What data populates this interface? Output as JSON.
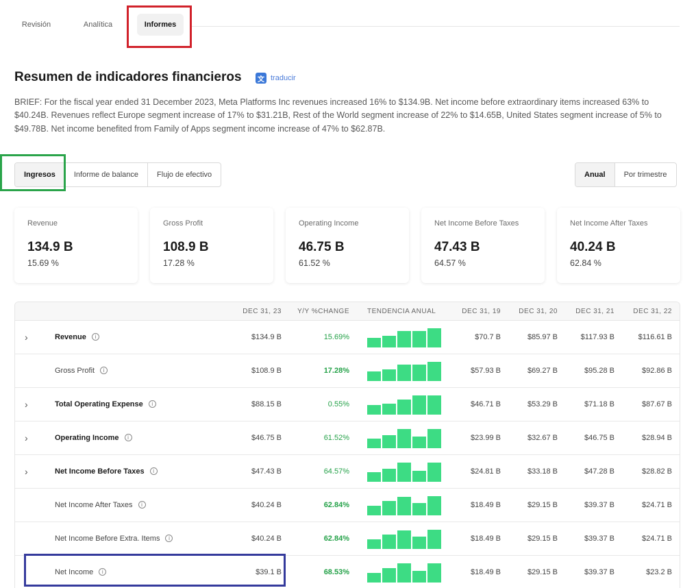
{
  "tabs": [
    "Revisión",
    "Analítica",
    "Informes"
  ],
  "title": "Resumen de indicadores financieros",
  "translate_label": "traducir",
  "translate_icon": "translate-icon",
  "brief": "BRIEF: For the fiscal year ended 31 December 2023, Meta Platforms Inc revenues increased 16% to $134.9B. Net income before extraordinary items increased 63% to $40.24B. Revenues reflect Europe segment increase of 17% to $31.21B, Rest of the World segment increase of 22% to $14.65B, United States segment increase of 5% to $49.78B. Net income benefited from Family of Apps segment income increase of 47% to $62.87B.",
  "statement_tabs": [
    "Ingresos",
    "Informe de balance",
    "Flujo de efectivo"
  ],
  "period_tabs": [
    "Anual",
    "Por trimestre"
  ],
  "cards": [
    {
      "label": "Revenue",
      "value": "134.9 B",
      "pct": "15.69 %"
    },
    {
      "label": "Gross Profit",
      "value": "108.9 B",
      "pct": "17.28 %"
    },
    {
      "label": "Operating Income",
      "value": "46.75 B",
      "pct": "61.52 %"
    },
    {
      "label": "Net Income Before Taxes",
      "value": "47.43 B",
      "pct": "64.57 %"
    },
    {
      "label": "Net Income After Taxes",
      "value": "40.24 B",
      "pct": "62.84 %"
    }
  ],
  "table": {
    "headers": [
      "DEC 31, 23",
      "Y/Y %CHANGE",
      "TENDENCIA ANUAL",
      "DEC 31, 19",
      "DEC 31, 20",
      "DEC 31, 21",
      "DEC 31, 22"
    ],
    "rows": [
      {
        "name": "Revenue",
        "bold": true,
        "expand": true,
        "cur": "$134.9 B",
        "chg": "15.69%",
        "chg_bold": false,
        "trend": [
          70.7,
          85.97,
          117.93,
          116.61,
          134.9
        ],
        "y19": "$70.7 B",
        "y20": "$85.97 B",
        "y21": "$117.93 B",
        "y22": "$116.61 B"
      },
      {
        "name": "Gross Profit",
        "bold": false,
        "expand": false,
        "cur": "$108.9 B",
        "chg": "17.28%",
        "chg_bold": true,
        "trend": [
          57.93,
          69.27,
          95.28,
          92.86,
          108.9
        ],
        "y19": "$57.93 B",
        "y20": "$69.27 B",
        "y21": "$95.28 B",
        "y22": "$92.86 B"
      },
      {
        "name": "Total Operating Expense",
        "bold": true,
        "expand": true,
        "cur": "$88.15 B",
        "chg": "0.55%",
        "chg_bold": false,
        "trend": [
          46.71,
          53.29,
          71.18,
          87.67,
          88.15
        ],
        "y19": "$46.71 B",
        "y20": "$53.29 B",
        "y21": "$71.18 B",
        "y22": "$87.67 B"
      },
      {
        "name": "Operating Income",
        "bold": true,
        "expand": true,
        "cur": "$46.75 B",
        "chg": "61.52%",
        "chg_bold": false,
        "trend": [
          23.99,
          32.67,
          46.75,
          28.94,
          46.75
        ],
        "y19": "$23.99 B",
        "y20": "$32.67 B",
        "y21": "$46.75 B",
        "y22": "$28.94 B"
      },
      {
        "name": "Net Income Before Taxes",
        "bold": true,
        "expand": true,
        "cur": "$47.43 B",
        "chg": "64.57%",
        "chg_bold": false,
        "trend": [
          24.81,
          33.18,
          47.28,
          28.82,
          47.43
        ],
        "y19": "$24.81 B",
        "y20": "$33.18 B",
        "y21": "$47.28 B",
        "y22": "$28.82 B"
      },
      {
        "name": "Net Income After Taxes",
        "bold": false,
        "expand": false,
        "cur": "$40.24 B",
        "chg": "62.84%",
        "chg_bold": true,
        "trend": [
          18.49,
          29.15,
          39.37,
          24.71,
          40.24
        ],
        "y19": "$18.49 B",
        "y20": "$29.15 B",
        "y21": "$39.37 B",
        "y22": "$24.71 B"
      },
      {
        "name": "Net Income Before Extra. Items",
        "bold": false,
        "expand": false,
        "cur": "$40.24 B",
        "chg": "62.84%",
        "chg_bold": true,
        "trend": [
          18.49,
          29.15,
          39.37,
          24.71,
          40.24
        ],
        "y19": "$18.49 B",
        "y20": "$29.15 B",
        "y21": "$39.37 B",
        "y22": "$24.71 B"
      },
      {
        "name": "Net Income",
        "bold": false,
        "expand": false,
        "cur": "$39.1 B",
        "chg": "68.53%",
        "chg_bold": true,
        "trend": [
          18.49,
          29.15,
          39.37,
          23.2,
          39.1
        ],
        "y19": "$18.49 B",
        "y20": "$29.15 B",
        "y21": "$39.37 B",
        "y22": "$23.2 B"
      }
    ]
  },
  "colors": {
    "accent_green": "#24a148",
    "spark_green": "#3ddc84",
    "highlight_red": "#d1212a",
    "highlight_green": "#2aa44a",
    "highlight_blue": "#343a9c"
  }
}
